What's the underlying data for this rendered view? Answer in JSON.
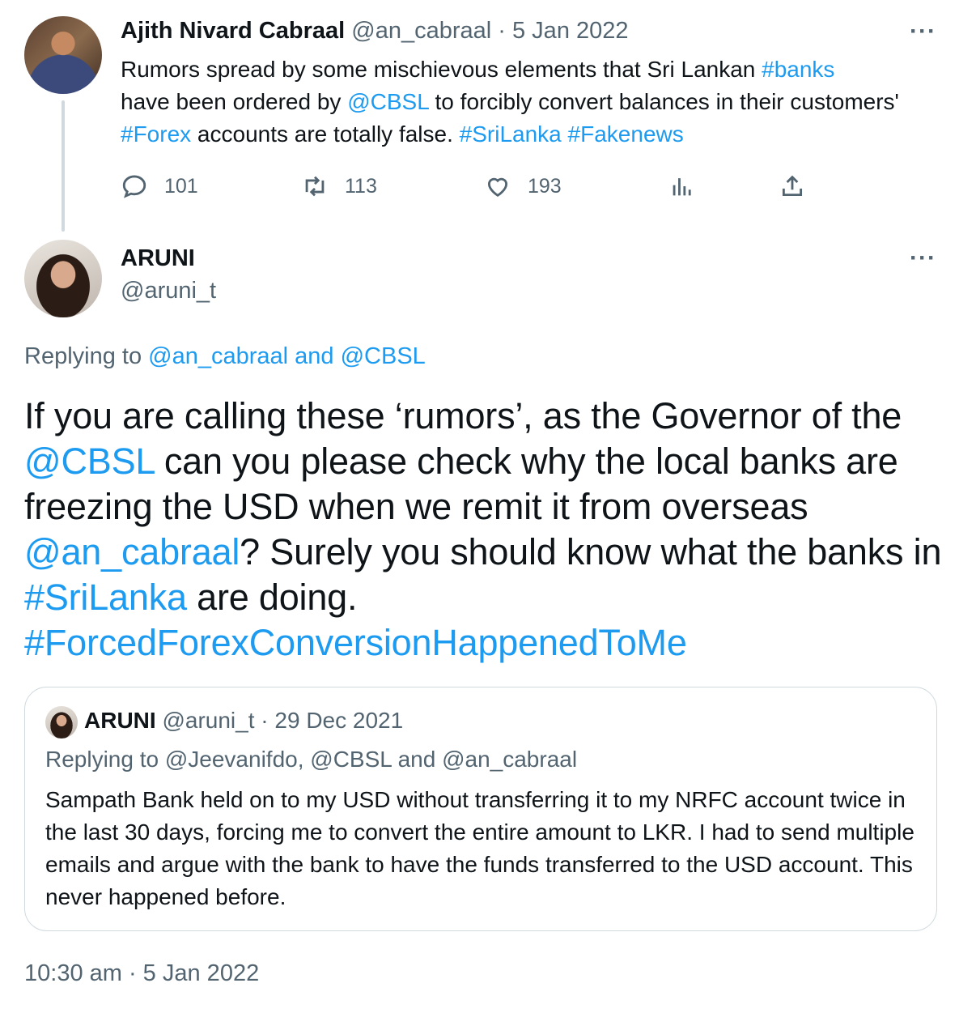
{
  "parent_tweet": {
    "name": "Ajith Nivard Cabraal",
    "handle": "@an_cabraal",
    "separator": "·",
    "date": "5 Jan 2022",
    "more": "···",
    "text_parts": {
      "t1": "Rumors spread by some mischievous elements that Sri Lankan ",
      "l1": "#banks",
      "t2": " have been ordered by ",
      "l2": "@CBSL",
      "t3": " to forcibly convert balances in their customers' ",
      "l3": "#Forex",
      "t4": " accounts are totally false. ",
      "l4": "#SriLanka",
      "t5": " ",
      "l5": "#Fakenews"
    },
    "actions": {
      "replies": "101",
      "retweets": "113",
      "likes": "193"
    }
  },
  "reply_tweet": {
    "name": "ARUNI",
    "handle": "@aruni_t",
    "more": "···",
    "replying": {
      "prefix": "Replying to ",
      "user1": "@an_cabraal",
      "and": " and ",
      "user2": "@CBSL"
    },
    "text_parts": {
      "t1": "If you are calling these ‘rumors’, as the Governor of the ",
      "l1": "@CBSL",
      "t2": " can you please check why the local banks are freezing the USD when we remit it from overseas ",
      "l2": "@an_cabraal",
      "t3": "? Surely you should know what the banks in ",
      "l3": "#SriLanka",
      "t4": " are doing.",
      "l4": "#ForcedForexConversionHappenedToMe"
    },
    "timestamp": "10:30 am · 5 Jan 2022"
  },
  "quoted_tweet": {
    "name": "ARUNI",
    "handle": "@aruni_t",
    "separator": "·",
    "date": "29 Dec 2021",
    "replying": "Replying to @Jeevanifdo, @CBSL and @an_cabraal",
    "text": "Sampath Bank held on to my USD without transferring it to my NRFC account twice in the last 30 days, forcing me to convert the entire amount to LKR. I had to send multiple emails and argue with the bank to have the funds transferred to the USD account. This never happened before."
  },
  "colors": {
    "link": "#1d9bf0",
    "muted": "#536471",
    "text": "#0f1419",
    "border": "#cfd9de"
  },
  "icons": [
    "reply-icon",
    "retweet-icon",
    "like-icon",
    "analytics-icon",
    "share-icon",
    "more-icon"
  ]
}
